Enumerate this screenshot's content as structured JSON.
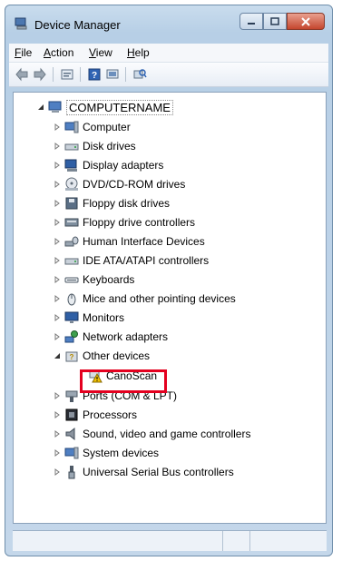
{
  "window": {
    "title": "Device Manager",
    "icon": "device-manager-icon"
  },
  "menu": [
    {
      "label": "File",
      "mnemonic": "F",
      "rest": "ile"
    },
    {
      "label": "Action",
      "mnemonic": "A",
      "rest": "ction"
    },
    {
      "label": "View",
      "mnemonic": "V",
      "rest": "iew"
    },
    {
      "label": "Help",
      "mnemonic": "H",
      "rest": "elp"
    }
  ],
  "toolbar": [
    "back-icon",
    "forward-icon",
    "properties-icon",
    "help-icon",
    "computer-view-icon",
    "scan-hardware-icon"
  ],
  "tree": {
    "root": "COMPUTERNAME",
    "items": [
      {
        "label": "Computer",
        "icon": "computer-icon"
      },
      {
        "label": "Disk drives",
        "icon": "disk-drive-icon"
      },
      {
        "label": "Display adapters",
        "icon": "display-adapter-icon"
      },
      {
        "label": "DVD/CD-ROM drives",
        "icon": "dvd-drive-icon"
      },
      {
        "label": "Floppy disk drives",
        "icon": "floppy-drive-icon"
      },
      {
        "label": "Floppy drive controllers",
        "icon": "floppy-controller-icon"
      },
      {
        "label": "Human Interface Devices",
        "icon": "hid-icon"
      },
      {
        "label": "IDE ATA/ATAPI controllers",
        "icon": "ide-controller-icon"
      },
      {
        "label": "Keyboards",
        "icon": "keyboard-icon"
      },
      {
        "label": "Mice and other pointing devices",
        "icon": "mouse-icon"
      },
      {
        "label": "Monitors",
        "icon": "monitor-icon"
      },
      {
        "label": "Network adapters",
        "icon": "network-adapter-icon"
      },
      {
        "label": "Other devices",
        "icon": "other-devices-icon",
        "expanded": true
      },
      {
        "label": "CanoScan",
        "icon": "warning-device-icon",
        "child": true
      },
      {
        "label": "Ports (COM & LPT)",
        "icon": "port-icon"
      },
      {
        "label": "Processors",
        "icon": "processor-icon"
      },
      {
        "label": "Sound, video and game controllers",
        "icon": "sound-icon"
      },
      {
        "label": "System devices",
        "icon": "system-device-icon"
      },
      {
        "label": "Universal Serial Bus controllers",
        "icon": "usb-icon"
      }
    ]
  },
  "colors": {
    "highlight": "#e4001f",
    "window_frame": "#b7cfe6"
  }
}
